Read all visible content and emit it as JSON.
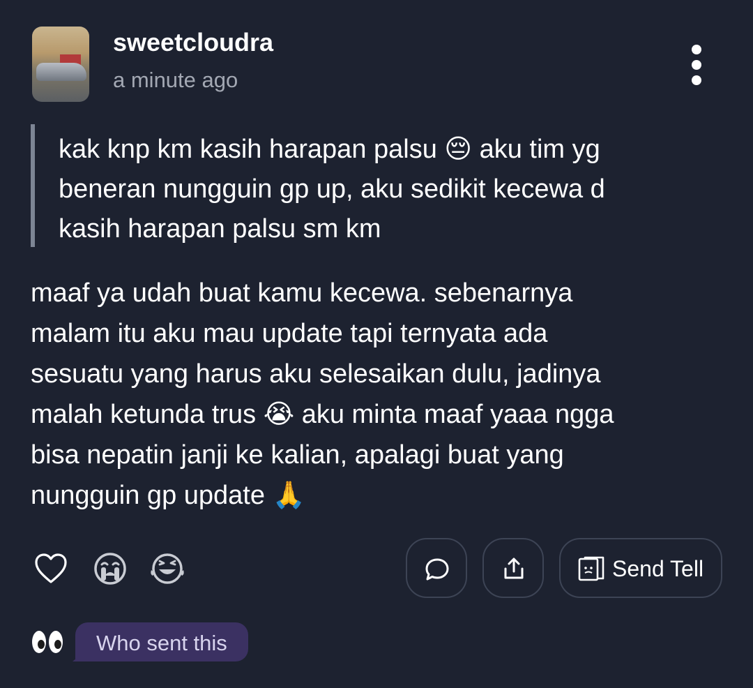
{
  "post": {
    "username": "sweetcloudra",
    "timestamp": "a minute ago",
    "question": "kak knp km kasih harapan palsu 😔 aku tim yg\nbeneran nungguin gp up, aku sedikit kecewa d\nkasih harapan palsu sm km",
    "answer": "maaf ya udah buat kamu kecewa. sebenarnya\nmalam itu aku mau update tapi ternyata ada\nsesuatu yang harus aku selesaikan dulu, jadinya\nmalah ketunda trus 😭 aku minta maaf yaaa ngga\nbisa nepatin janji ke kalian, apalagi buat yang\nnungguin gp update 🙏"
  },
  "reactions": [
    "heart-icon",
    "crying-face-icon",
    "laughing-face-icon"
  ],
  "actions": {
    "comment_icon": "comment-bubble-icon",
    "share_icon": "share-upload-icon",
    "send_tell_icon": "tell-card-icon",
    "send_tell_label": "Send Tell"
  },
  "footer": {
    "eyes_icon": "eyes-icon",
    "who_sent_label": "Who sent this"
  },
  "colors": {
    "background": "#1d2230",
    "button_border": "#3d4455",
    "quote_bar": "#7d8594",
    "who_sent_bubble": "#3b3162"
  }
}
